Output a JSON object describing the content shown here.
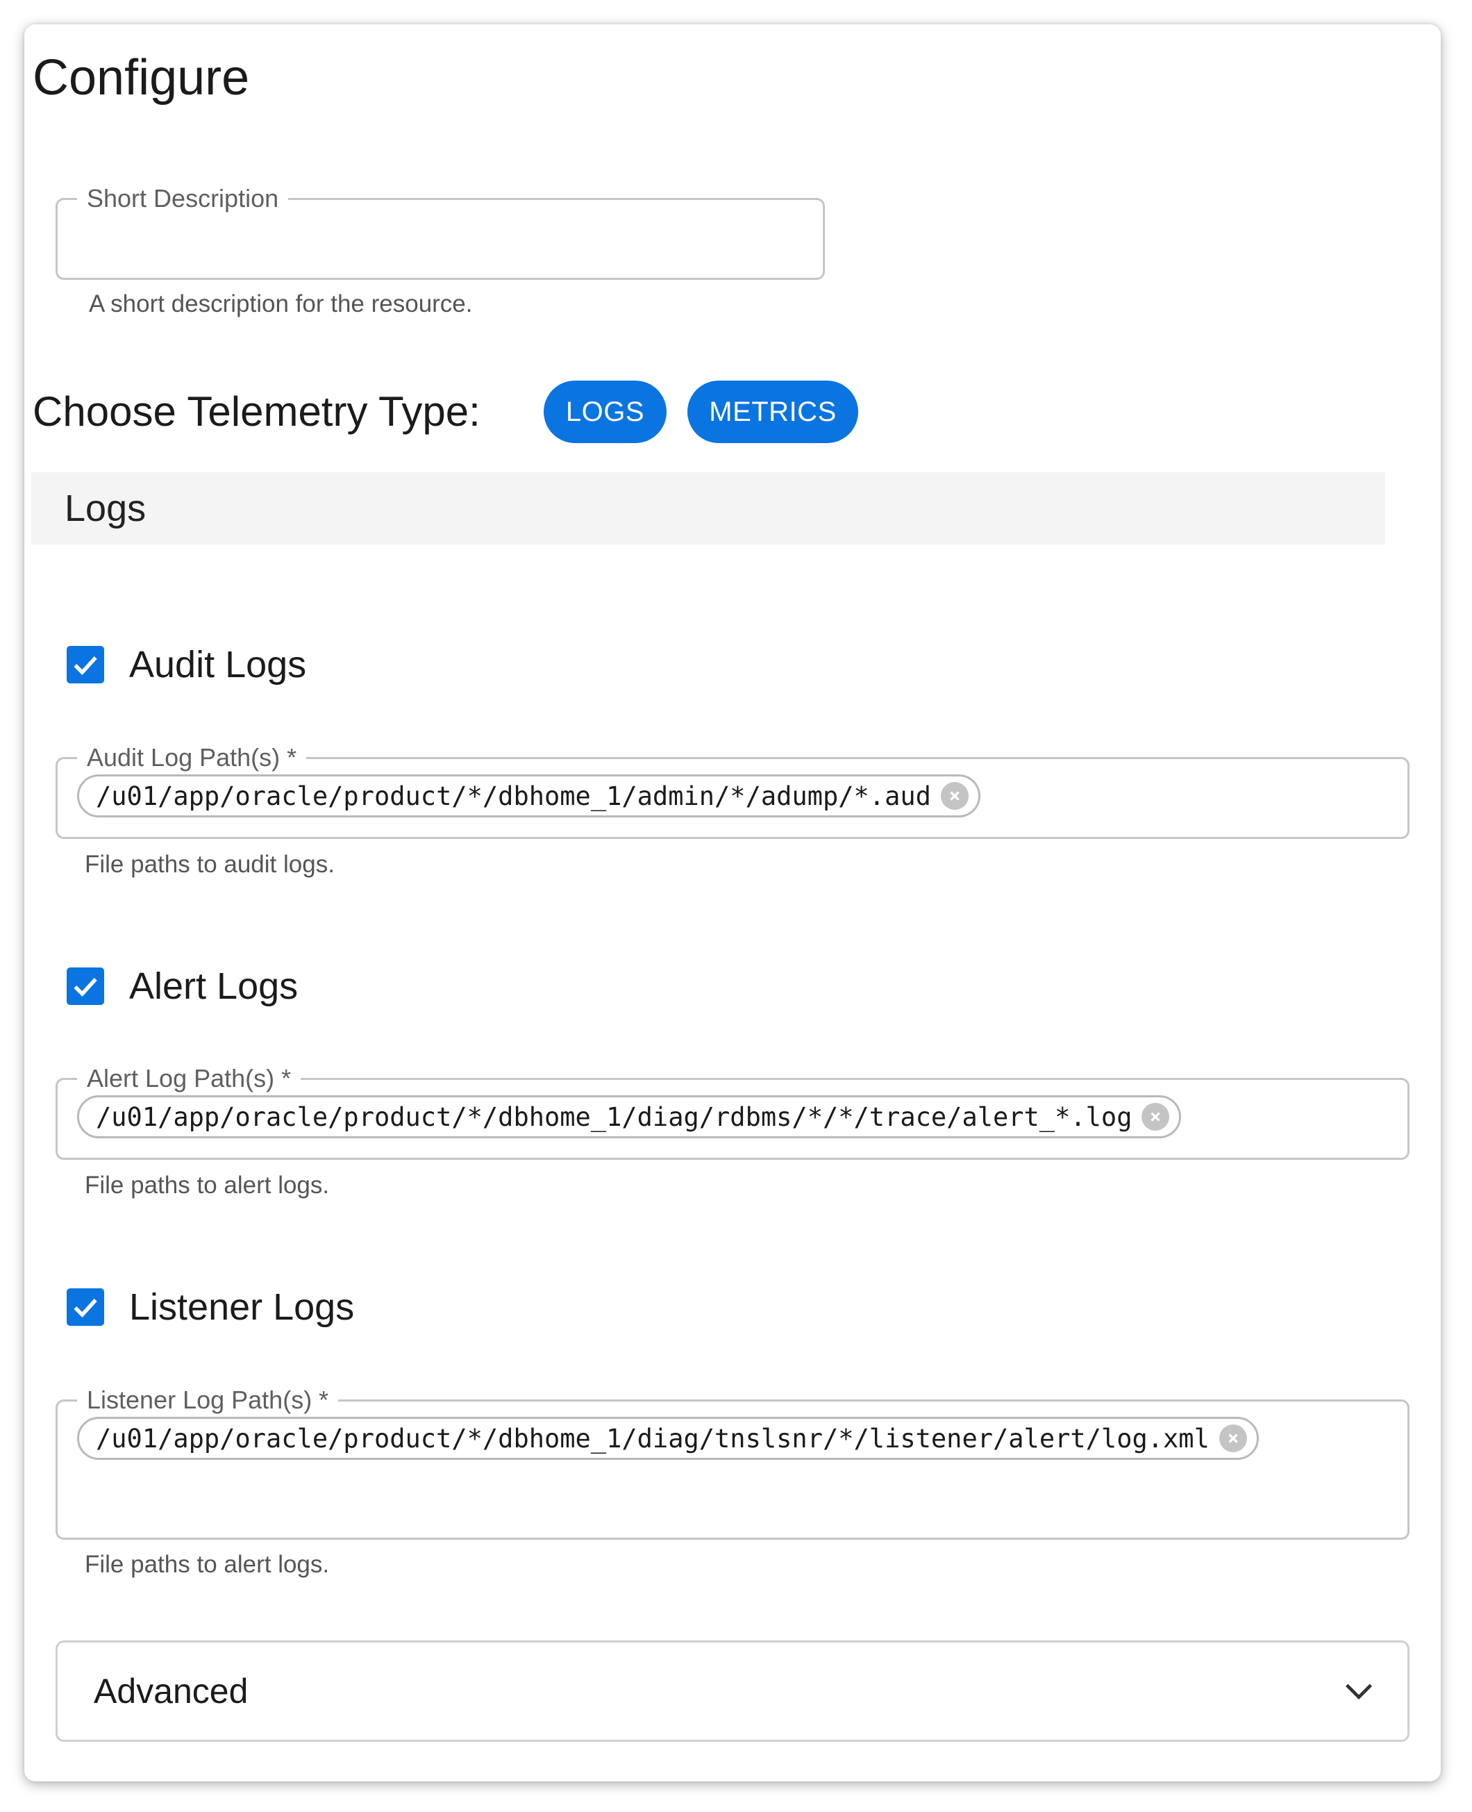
{
  "page": {
    "title": "Configure"
  },
  "short_description": {
    "label": "Short Description",
    "value": "",
    "helper": "A short description for the resource."
  },
  "telemetry": {
    "label": "Choose Telemetry Type:",
    "buttons": [
      {
        "label": "LOGS"
      },
      {
        "label": "METRICS"
      }
    ]
  },
  "logs_section": {
    "title": "Logs"
  },
  "log_groups": [
    {
      "checkbox_label": "Audit Logs",
      "checked": true,
      "field_label": "Audit Log Path(s) *",
      "paths": [
        "/u01/app/oracle/product/*/dbhome_1/admin/*/adump/*.aud"
      ],
      "helper": "File paths to audit logs."
    },
    {
      "checkbox_label": "Alert Logs",
      "checked": true,
      "field_label": "Alert Log Path(s) *",
      "paths": [
        "/u01/app/oracle/product/*/dbhome_1/diag/rdbms/*/*/trace/alert_*.log"
      ],
      "helper": "File paths to alert logs."
    },
    {
      "checkbox_label": "Listener Logs",
      "checked": true,
      "field_label": "Listener Log Path(s) *",
      "paths": [
        "/u01/app/oracle/product/*/dbhome_1/diag/tnslsnr/*/listener/alert/log.xml"
      ],
      "helper": "File paths to alert logs."
    }
  ],
  "advanced": {
    "label": "Advanced"
  },
  "colors": {
    "accent": "#0a74e0",
    "section_bg": "#f4f4f4",
    "border": "#c6c6c6"
  }
}
